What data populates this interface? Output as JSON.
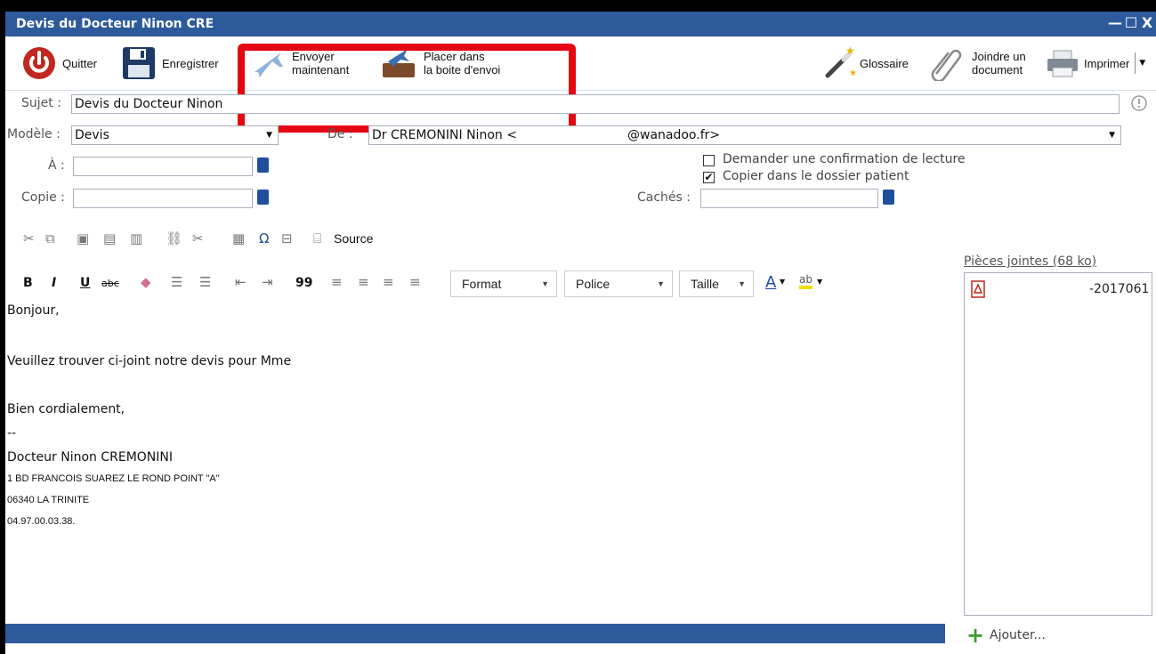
{
  "window": {
    "title": "Devis du Docteur Ninon CRE",
    "controls": [
      "—",
      "☐",
      "X"
    ]
  },
  "ribbon": {
    "quit": "Quitter",
    "save": "Enregistrer",
    "send_now": "Envoyer\nmaintenant",
    "outbox": "Placer dans\nla boite d'envoi",
    "glossary": "Glossaire",
    "attach": "Joindre un\ndocument",
    "print": "Imprimer"
  },
  "form": {
    "subject_label": "Sujet :",
    "subject_value": "Devis du Docteur Ninon",
    "template_label": "Modèle :",
    "template_value": "Devis",
    "from_label": "De :",
    "from_value": "Dr CREMONINI Ninon <",
    "from_domain": "@wanadoo.fr>",
    "to_label": "À :",
    "cc_label": "Copie :",
    "bcc_label": "Cachés :",
    "read_receipt": "Demander une confirmation de lecture",
    "copy_patient": "Copier dans le dossier patient",
    "read_receipt_checked": false,
    "copy_patient_checked": true
  },
  "toolbar": {
    "source": "Source",
    "bold": "B",
    "italic": "I",
    "underline": "U",
    "strike": "abc",
    "quote": "99",
    "format": "Format",
    "font": "Police",
    "size": "Taille",
    "font_color": "A",
    "highlight": "ab"
  },
  "body": {
    "greeting": "Bonjour,",
    "line1": "Veuillez trouver ci-joint notre devis pour Mme",
    "closing": "Bien cordialement,",
    "sep": "--",
    "signature_name": "Docteur Ninon CREMONINI",
    "address1": "1 BD FRANCOIS SUAREZ LE ROND POINT \"A\"",
    "address2": "06340 LA TRINITE",
    "phone": "04.97.00.03.38."
  },
  "attachments": {
    "header": "Pièces jointes (68 ko)",
    "files": [
      "-2017061"
    ],
    "add": "Ajouter..."
  },
  "colors": {
    "title_bar": "#2d5a9b",
    "highlight_box": "#e30613",
    "quit_icon": "#c0281f"
  }
}
